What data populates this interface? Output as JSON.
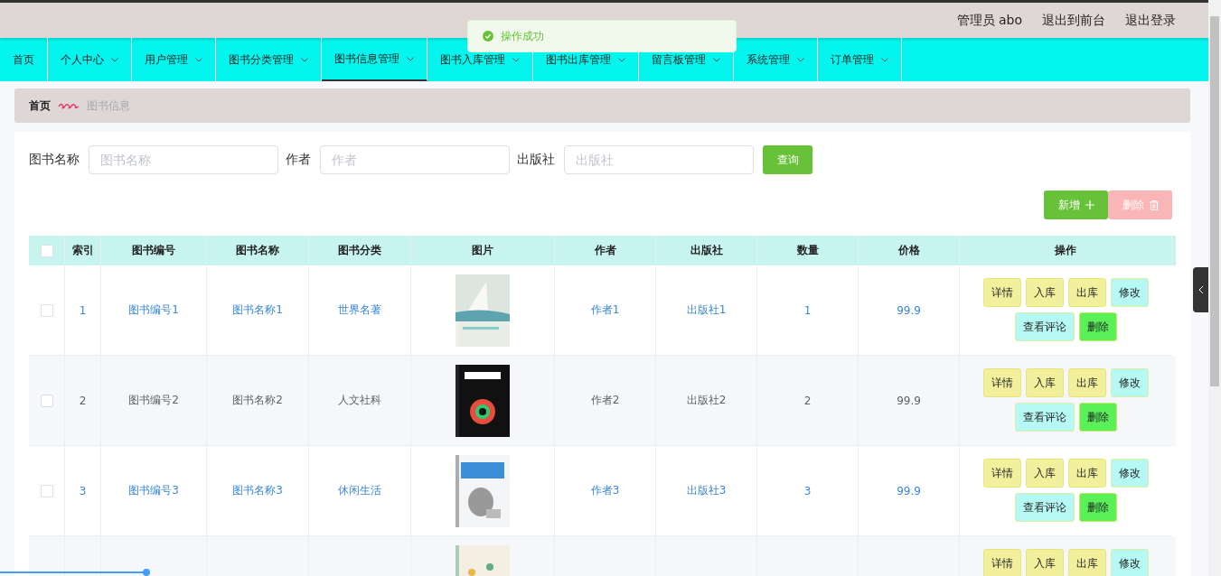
{
  "header": {
    "user": "管理员 abo",
    "links": [
      "退出到前台",
      "退出登录"
    ]
  },
  "toast": {
    "message": "操作成功"
  },
  "nav": [
    {
      "label": "首页",
      "dropdown": false,
      "selected": false
    },
    {
      "label": "个人中心",
      "dropdown": true,
      "selected": false
    },
    {
      "label": "用户管理",
      "dropdown": true,
      "selected": false
    },
    {
      "label": "图书分类管理",
      "dropdown": true,
      "selected": false
    },
    {
      "label": "图书信息管理",
      "dropdown": true,
      "selected": true
    },
    {
      "label": "图书入库管理",
      "dropdown": true,
      "selected": false
    },
    {
      "label": "图书出库管理",
      "dropdown": true,
      "selected": false
    },
    {
      "label": "留言板管理",
      "dropdown": true,
      "selected": false
    },
    {
      "label": "系统管理",
      "dropdown": true,
      "selected": false
    },
    {
      "label": "订单管理",
      "dropdown": true,
      "selected": false
    }
  ],
  "breadcrumb": {
    "home": "首页",
    "current": "图书信息"
  },
  "search": [
    {
      "label": "图书名称",
      "placeholder": "图书名称"
    },
    {
      "label": "作者",
      "placeholder": "作者"
    },
    {
      "label": "出版社",
      "placeholder": "出版社"
    }
  ],
  "query_button": "查询",
  "toolbar": [
    {
      "kind": "add",
      "label": "新增",
      "disabled": false
    },
    {
      "kind": "delete",
      "label": "删除",
      "disabled": true
    }
  ],
  "table": {
    "select_all": {
      "checked": false
    },
    "columns": [
      "索引",
      "图书编号",
      "图书名称",
      "图书分类",
      "图片",
      "作者",
      "出版社",
      "数量",
      "价格",
      "操作"
    ],
    "rows": [
      {
        "checked": false,
        "cells": [
          "1",
          "图书编号1",
          "图书名称1",
          "世界名著",
          null,
          "作者1",
          "出版社1",
          "1",
          "99.9"
        ],
        "image": {
          "kind": "picture"
        },
        "actions": [
          {
            "kind": "detail",
            "label": "详情"
          },
          {
            "kind": "stock-in",
            "label": "入库"
          },
          {
            "kind": "stock-out",
            "label": "出库"
          },
          {
            "kind": "edit",
            "label": "修改"
          },
          {
            "kind": "comments",
            "label": "查看评论"
          },
          {
            "kind": "delete",
            "label": "删除"
          }
        ]
      },
      {
        "checked": false,
        "cells": [
          "2",
          "图书编号2",
          "图书名称2",
          "人文社科",
          null,
          "作者2",
          "出版社2",
          "2",
          "99.9"
        ],
        "image": {
          "kind": "picture"
        },
        "actions": [
          {
            "kind": "detail",
            "label": "详情"
          },
          {
            "kind": "stock-in",
            "label": "入库"
          },
          {
            "kind": "stock-out",
            "label": "出库"
          },
          {
            "kind": "edit",
            "label": "修改"
          },
          {
            "kind": "comments",
            "label": "查看评论"
          },
          {
            "kind": "delete",
            "label": "删除"
          }
        ]
      },
      {
        "checked": false,
        "cells": [
          "3",
          "图书编号3",
          "图书名称3",
          "休闲生活",
          null,
          "作者3",
          "出版社3",
          "3",
          "99.9"
        ],
        "image": {
          "kind": "picture"
        },
        "actions": [
          {
            "kind": "detail",
            "label": "详情"
          },
          {
            "kind": "stock-in",
            "label": "入库"
          },
          {
            "kind": "stock-out",
            "label": "出库"
          },
          {
            "kind": "edit",
            "label": "修改"
          },
          {
            "kind": "comments",
            "label": "查看评论"
          },
          {
            "kind": "delete",
            "label": "删除"
          }
        ]
      },
      {
        "image": {
          "kind": "picture"
        },
        "actions": [
          {
            "kind": "detail",
            "label": "详情"
          },
          {
            "kind": "stock-in",
            "label": "入库"
          },
          {
            "kind": "stock-out",
            "label": "出库"
          },
          {
            "kind": "edit",
            "label": "修改"
          }
        ]
      }
    ]
  }
}
